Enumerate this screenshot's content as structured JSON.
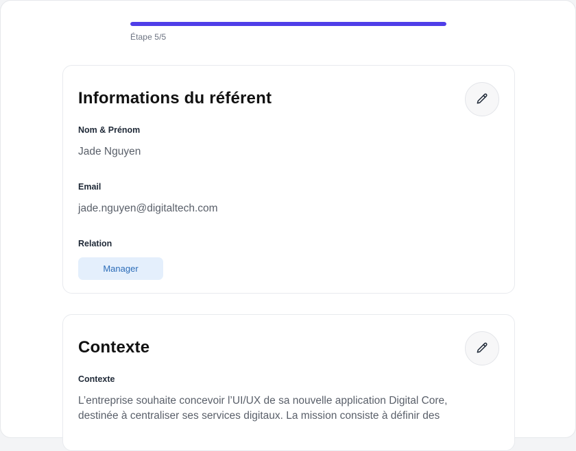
{
  "progress": {
    "fraction": 1.0,
    "step_label": "Étape 5/5",
    "color": "#4f3ee8"
  },
  "referent": {
    "title": "Informations du référent",
    "edit_icon": "pencil-icon",
    "name_label": "Nom & Prénom",
    "name_value": "Jade Nguyen",
    "email_label": "Email",
    "email_value": "jade.nguyen@digitaltech.com",
    "relation_label": "Relation",
    "relation_value": "Manager"
  },
  "contexte": {
    "title": "Contexte",
    "edit_icon": "pencil-icon",
    "field_label": "Contexte",
    "text": "L’entreprise souhaite concevoir l’UI/UX de sa nouvelle application Digital Core, destinée à centraliser ses services digitaux. La mission consiste à définir des"
  }
}
